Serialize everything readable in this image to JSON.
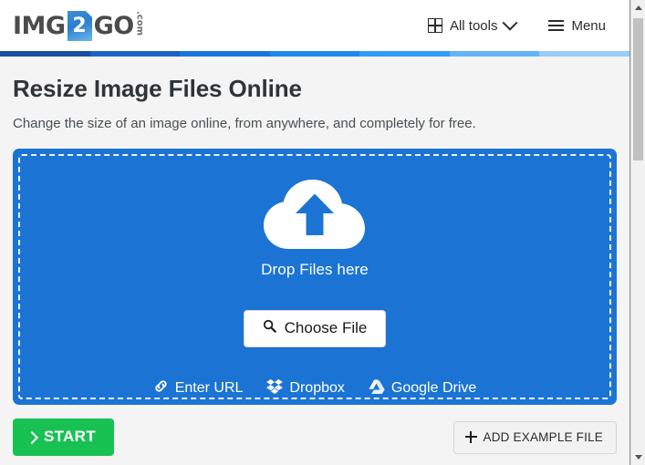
{
  "header": {
    "logo": {
      "word1": "IMG",
      "badge": "2",
      "word2": "GO",
      "tld": ".com"
    },
    "nav": [
      {
        "icon": "grid-icon",
        "label": "All tools",
        "chevron": "chevron-down-icon"
      },
      {
        "icon": "hamburger-icon",
        "label": "Menu"
      }
    ]
  },
  "gradient_bar": {
    "colors": [
      "#17509f",
      "#1b63c4",
      "#1a76dd",
      "#1e87ef",
      "#2e9bf7",
      "#63b4f7",
      "#96cdf9"
    ]
  },
  "main": {
    "title": "Resize Image Files Online",
    "subtitle": "Change the size of an image online, from anywhere, and completely for free."
  },
  "dropzone": {
    "background_color": "#1b74d4",
    "cloud_icon": "cloud-upload-icon",
    "drop_label": "Drop Files here",
    "choose_file": {
      "icon": "search-icon",
      "label": "Choose File"
    },
    "sources": [
      {
        "icon": "link-icon",
        "label": "Enter URL"
      },
      {
        "icon": "dropbox-icon",
        "label": "Dropbox"
      },
      {
        "icon": "google-drive-icon",
        "label": "Google Drive"
      }
    ]
  },
  "actions": {
    "start": {
      "icon": "chevron-right-icon",
      "label": "START",
      "color": "#18c252"
    },
    "add_example": {
      "icon": "plus-icon",
      "label": "ADD EXAMPLE FILE"
    }
  },
  "scrollbar": {
    "up_arrow": "scroll-up-arrow-icon",
    "down_arrow": "scroll-down-arrow-icon"
  }
}
